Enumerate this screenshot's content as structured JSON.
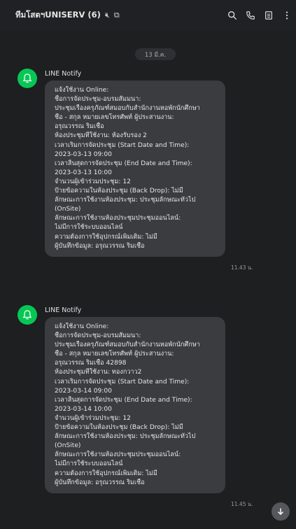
{
  "header": {
    "title": "ทีมโสตฯUNISERV (6)",
    "mute_icon": "speaker-muted-icon",
    "external_icon": "open-external-icon",
    "actions": [
      "search-icon",
      "phone-icon",
      "notes-icon",
      "more-icon"
    ]
  },
  "date_chip": "13 มี.ค.",
  "messages": [
    {
      "sender": "LINE Notify",
      "time": "11.43 น.",
      "lines": [
        "แจ้งใช้งาน Online:",
        "ชื่อการจัดประชุม-อบรมสัมมนา:",
        "ประชุมเรื่องครุภัณฑ์สมอบกับสำนักงานหอพักนักศึกษา",
        "  ชื่อ - สกุล หมายเลขโทรศัพท์ ผู้ประสานงาน:",
        "อรุณวรรณ ริมเชื้อ",
        "ห้องประชุมที่ใช้งาน: ห้องรับรอง 2",
        "เวลาเริ่มการจัดประชุม (Start Date and Time):",
        "2023-03-13 09:00",
        "เวลาสิ้นสุดการจัดประชุม (End Date and Time):",
        "2023-03-13 10:00",
        "จำนวนผู้เข้าร่วมประชุม: 12",
        "ป้ายข้อความในห้องประชุม (Back Drop): ไม่มี",
        "ลักษณะการใช้งานห้องประชุม: ประชุมลักษณะทั่วไป",
        "(OnSite)",
        "ลักษณะการใช้งานห้องประชุมประชุมออนไลน์:",
        "ไม่มีการใช้ระบบออนไลน์",
        "ความต้องการใช้อุปกรณ์เพิ่มเติม: ไม่มี",
        "ผู้บันทึกข้อมูล: อรุณวรรณ ริมเชื้อ"
      ]
    },
    {
      "sender": "LINE Notify",
      "time": "11.45 น.",
      "lines": [
        "แจ้งใช้งาน Online:",
        "ชื่อการจัดประชุม-อบรมสัมมนา:",
        "ประชุมเรื่องครุภัณฑ์สมอบกับสำนักงานหอพักนักศึกษา",
        "  ชื่อ - สกุล หมายเลขโทรศัพท์ ผู้ประสานงาน:",
        "อรุณวรรณ ริมเชื้อ  42898",
        "ห้องประชุมที่ใช้งาน: ทองกวาว2",
        "เวลาเริ่มการจัดประชุม (Start Date and Time):",
        "2023-03-14 09:00",
        "เวลาสิ้นสุดการจัดประชุม (End Date and Time):",
        "2023-03-14 10:00",
        "จำนวนผู้เข้าร่วมประชุม: 12",
        "ป้ายข้อความในห้องประชุม (Back Drop): ไม่มี",
        "ลักษณะการใช้งานห้องประชุม: ประชุมลักษณะทั่วไป",
        "(OnSite)",
        "ลักษณะการใช้งานห้องประชุมประชุมออนไลน์:",
        "ไม่มีการใช้ระบบออนไลน์",
        "ความต้องการใช้อุปกรณ์เพิ่มเติม: ไม่มี",
        "ผู้บันทึกข้อมูล: อรุณวรรณ ริมเชื้อ"
      ]
    }
  ],
  "scroll_button": {
    "icon": "arrow-down-icon"
  }
}
